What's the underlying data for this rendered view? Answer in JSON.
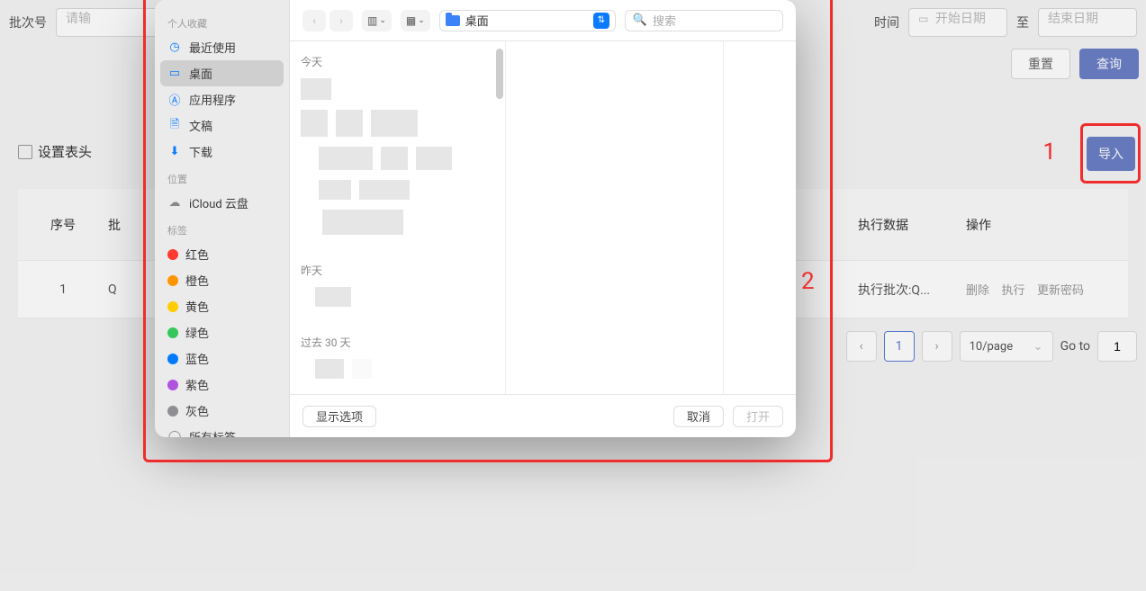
{
  "bg": {
    "batch_label": "批次号",
    "batch_placeholder": "请输",
    "time_label": "时间",
    "start_date": "开始日期",
    "sep": "至",
    "end_date": "结束日期",
    "reset": "重置",
    "query": "查询",
    "set_header": "设置表头",
    "import": "导入",
    "annotation1": "1",
    "annotation2": "2"
  },
  "table": {
    "headers": {
      "seq": "序号",
      "batch": "批",
      "exec_data": "执行数据",
      "ops": "操作"
    },
    "row": {
      "seq": "1",
      "batch": "Q",
      "exec": "执行批次:Q...",
      "op_del": "删除",
      "op_run": "执行",
      "op_pwd": "更新密码"
    }
  },
  "pager": {
    "page": "1",
    "size": "10/page",
    "goto": "Go to",
    "goto_val": "1"
  },
  "finder": {
    "sidebar": {
      "fav": "个人收藏",
      "recent": "最近使用",
      "desktop": "桌面",
      "apps": "应用程序",
      "docs": "文稿",
      "downloads": "下载",
      "loc": "位置",
      "icloud": "iCloud 云盘",
      "tags": "标签",
      "red": "红色",
      "orange": "橙色",
      "yellow": "黄色",
      "green": "绿色",
      "blue": "蓝色",
      "purple": "紫色",
      "gray": "灰色",
      "all": "所有标签…"
    },
    "toolbar": {
      "location": "桌面",
      "search_placeholder": "搜索"
    },
    "body": {
      "today": "今天",
      "yesterday": "昨天",
      "month": "过去 30 天"
    },
    "footer": {
      "options": "显示选项",
      "cancel": "取消",
      "open": "打开"
    }
  }
}
